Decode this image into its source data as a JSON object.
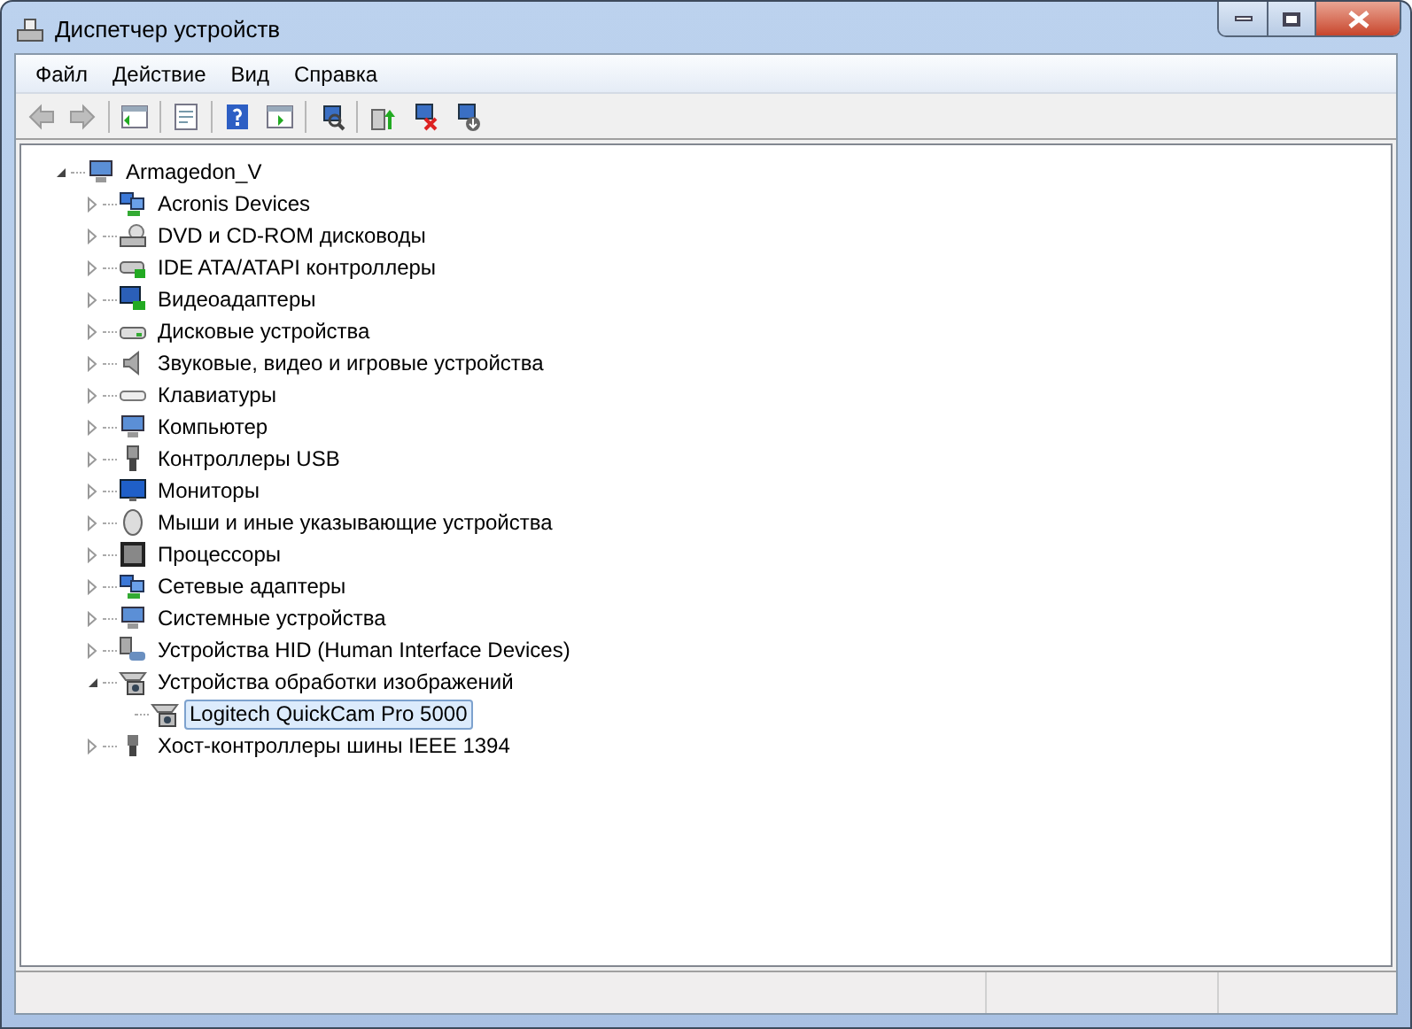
{
  "window": {
    "title": "Диспетчер устройств"
  },
  "menu": [
    "Файл",
    "Действие",
    "Вид",
    "Справка"
  ],
  "toolbar": [
    {
      "kind": "back",
      "disabled": true
    },
    {
      "kind": "forward",
      "disabled": true
    },
    {
      "kind": "separator"
    },
    {
      "kind": "tree",
      "disabled": false
    },
    {
      "kind": "separator"
    },
    {
      "kind": "properties",
      "disabled": false
    },
    {
      "kind": "separator"
    },
    {
      "kind": "help",
      "disabled": false
    },
    {
      "kind": "pane",
      "disabled": false
    },
    {
      "kind": "separator"
    },
    {
      "kind": "scan",
      "disabled": false
    },
    {
      "kind": "separator"
    },
    {
      "kind": "update",
      "disabled": false
    },
    {
      "kind": "uninstall",
      "disabled": false
    },
    {
      "kind": "disable",
      "disabled": false
    }
  ],
  "tree": {
    "label": "Armagedon_V",
    "expanded": true,
    "children": [
      {
        "label": "Acronis Devices",
        "expanded": false
      },
      {
        "label": "DVD и CD-ROM дисководы",
        "expanded": false
      },
      {
        "label": "IDE ATA/ATAPI контроллеры",
        "expanded": false
      },
      {
        "label": "Видеоадаптеры",
        "expanded": false
      },
      {
        "label": "Дисковые устройства",
        "expanded": false
      },
      {
        "label": "Звуковые, видео и игровые устройства",
        "expanded": false
      },
      {
        "label": "Клавиатуры",
        "expanded": false
      },
      {
        "label": "Компьютер",
        "expanded": false
      },
      {
        "label": "Контроллеры USB",
        "expanded": false
      },
      {
        "label": "Мониторы",
        "expanded": false
      },
      {
        "label": "Мыши и иные указывающие устройства",
        "expanded": false
      },
      {
        "label": "Процессоры",
        "expanded": false
      },
      {
        "label": "Сетевые адаптеры",
        "expanded": false
      },
      {
        "label": "Системные устройства",
        "expanded": false
      },
      {
        "label": "Устройства HID (Human Interface Devices)",
        "expanded": false
      },
      {
        "label": "Устройства обработки изображений",
        "expanded": true,
        "children": [
          {
            "label": "Logitech QuickCam Pro 5000",
            "selected": true
          }
        ]
      },
      {
        "label": "Хост-контроллеры шины IEEE 1394",
        "expanded": false
      }
    ]
  }
}
